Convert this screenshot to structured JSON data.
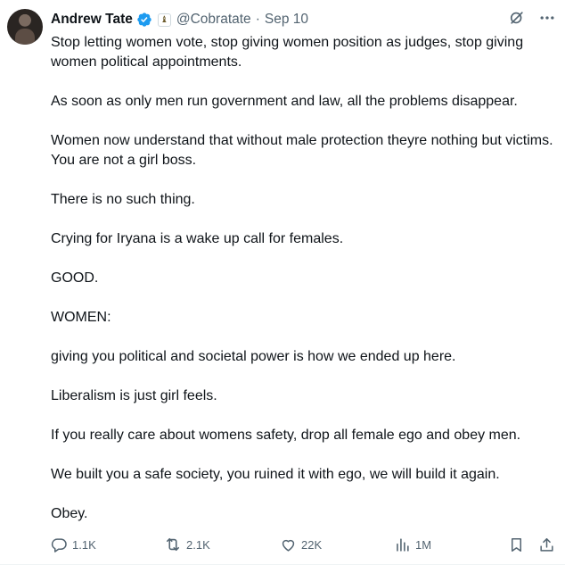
{
  "author": {
    "name": "Andrew Tate",
    "handle": "@Cobratate",
    "separator": "·",
    "date": "Sep 10",
    "affiliate_badge": "♝"
  },
  "icons": {
    "verified": "verified-badge-icon",
    "grok": "grok-icon",
    "more": "more-icon",
    "reply": "reply-icon",
    "retweet": "retweet-icon",
    "like": "heart-icon",
    "views": "views-icon",
    "bookmark": "bookmark-icon",
    "share": "share-icon"
  },
  "colors": {
    "accent": "#1d9bf0",
    "muted": "#536471",
    "text": "#0f1419"
  },
  "tweet": {
    "paragraphs": [
      "Stop letting women vote, stop giving women position as judges, stop giving women political appointments.",
      "As soon as only men run government and law, all the problems disappear.",
      "Women now understand that without male protection theyre nothing but victims. You are not a girl boss.",
      "There is no such thing.",
      "Crying for Iryana is a wake up call for females.",
      "GOOD.",
      "WOMEN:",
      "giving you political and societal power is how we ended up here.",
      "Liberalism is just girl feels.",
      "If you really care about womens safety, drop all female ego and obey men.",
      "We built you a safe society, you ruined it with ego, we will build it again.",
      "Obey."
    ]
  },
  "stats": {
    "replies": "1.1K",
    "retweets": "2.1K",
    "likes": "22K",
    "views": "1M"
  }
}
